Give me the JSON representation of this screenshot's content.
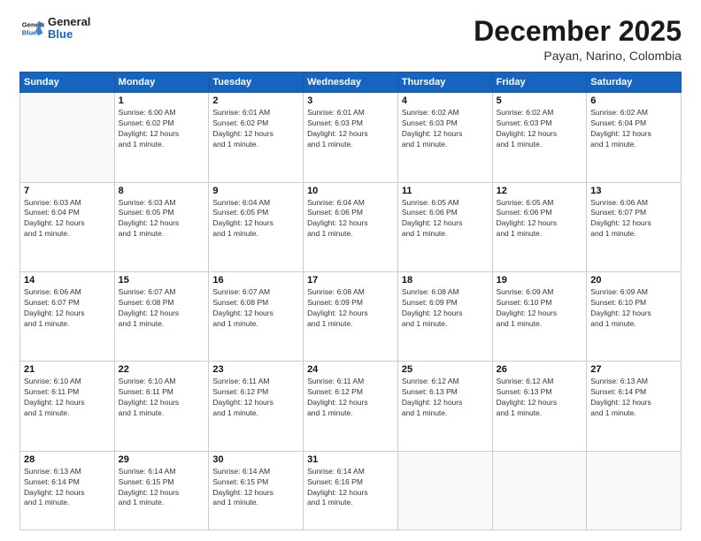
{
  "logo": {
    "line1": "General",
    "line2": "Blue"
  },
  "title": "December 2025",
  "location": "Payan, Narino, Colombia",
  "header_days": [
    "Sunday",
    "Monday",
    "Tuesday",
    "Wednesday",
    "Thursday",
    "Friday",
    "Saturday"
  ],
  "weeks": [
    [
      {
        "day": "",
        "info": ""
      },
      {
        "day": "1",
        "info": "Sunrise: 6:00 AM\nSunset: 6:02 PM\nDaylight: 12 hours\nand 1 minute."
      },
      {
        "day": "2",
        "info": "Sunrise: 6:01 AM\nSunset: 6:02 PM\nDaylight: 12 hours\nand 1 minute."
      },
      {
        "day": "3",
        "info": "Sunrise: 6:01 AM\nSunset: 6:03 PM\nDaylight: 12 hours\nand 1 minute."
      },
      {
        "day": "4",
        "info": "Sunrise: 6:02 AM\nSunset: 6:03 PM\nDaylight: 12 hours\nand 1 minute."
      },
      {
        "day": "5",
        "info": "Sunrise: 6:02 AM\nSunset: 6:03 PM\nDaylight: 12 hours\nand 1 minute."
      },
      {
        "day": "6",
        "info": "Sunrise: 6:02 AM\nSunset: 6:04 PM\nDaylight: 12 hours\nand 1 minute."
      }
    ],
    [
      {
        "day": "7",
        "info": "Sunrise: 6:03 AM\nSunset: 6:04 PM\nDaylight: 12 hours\nand 1 minute."
      },
      {
        "day": "8",
        "info": "Sunrise: 6:03 AM\nSunset: 6:05 PM\nDaylight: 12 hours\nand 1 minute."
      },
      {
        "day": "9",
        "info": "Sunrise: 6:04 AM\nSunset: 6:05 PM\nDaylight: 12 hours\nand 1 minute."
      },
      {
        "day": "10",
        "info": "Sunrise: 6:04 AM\nSunset: 6:06 PM\nDaylight: 12 hours\nand 1 minute."
      },
      {
        "day": "11",
        "info": "Sunrise: 6:05 AM\nSunset: 6:06 PM\nDaylight: 12 hours\nand 1 minute."
      },
      {
        "day": "12",
        "info": "Sunrise: 6:05 AM\nSunset: 6:06 PM\nDaylight: 12 hours\nand 1 minute."
      },
      {
        "day": "13",
        "info": "Sunrise: 6:06 AM\nSunset: 6:07 PM\nDaylight: 12 hours\nand 1 minute."
      }
    ],
    [
      {
        "day": "14",
        "info": "Sunrise: 6:06 AM\nSunset: 6:07 PM\nDaylight: 12 hours\nand 1 minute."
      },
      {
        "day": "15",
        "info": "Sunrise: 6:07 AM\nSunset: 6:08 PM\nDaylight: 12 hours\nand 1 minute."
      },
      {
        "day": "16",
        "info": "Sunrise: 6:07 AM\nSunset: 6:08 PM\nDaylight: 12 hours\nand 1 minute."
      },
      {
        "day": "17",
        "info": "Sunrise: 6:08 AM\nSunset: 6:09 PM\nDaylight: 12 hours\nand 1 minute."
      },
      {
        "day": "18",
        "info": "Sunrise: 6:08 AM\nSunset: 6:09 PM\nDaylight: 12 hours\nand 1 minute."
      },
      {
        "day": "19",
        "info": "Sunrise: 6:09 AM\nSunset: 6:10 PM\nDaylight: 12 hours\nand 1 minute."
      },
      {
        "day": "20",
        "info": "Sunrise: 6:09 AM\nSunset: 6:10 PM\nDaylight: 12 hours\nand 1 minute."
      }
    ],
    [
      {
        "day": "21",
        "info": "Sunrise: 6:10 AM\nSunset: 6:11 PM\nDaylight: 12 hours\nand 1 minute."
      },
      {
        "day": "22",
        "info": "Sunrise: 6:10 AM\nSunset: 6:11 PM\nDaylight: 12 hours\nand 1 minute."
      },
      {
        "day": "23",
        "info": "Sunrise: 6:11 AM\nSunset: 6:12 PM\nDaylight: 12 hours\nand 1 minute."
      },
      {
        "day": "24",
        "info": "Sunrise: 6:11 AM\nSunset: 6:12 PM\nDaylight: 12 hours\nand 1 minute."
      },
      {
        "day": "25",
        "info": "Sunrise: 6:12 AM\nSunset: 6:13 PM\nDaylight: 12 hours\nand 1 minute."
      },
      {
        "day": "26",
        "info": "Sunrise: 6:12 AM\nSunset: 6:13 PM\nDaylight: 12 hours\nand 1 minute."
      },
      {
        "day": "27",
        "info": "Sunrise: 6:13 AM\nSunset: 6:14 PM\nDaylight: 12 hours\nand 1 minute."
      }
    ],
    [
      {
        "day": "28",
        "info": "Sunrise: 6:13 AM\nSunset: 6:14 PM\nDaylight: 12 hours\nand 1 minute."
      },
      {
        "day": "29",
        "info": "Sunrise: 6:14 AM\nSunset: 6:15 PM\nDaylight: 12 hours\nand 1 minute."
      },
      {
        "day": "30",
        "info": "Sunrise: 6:14 AM\nSunset: 6:15 PM\nDaylight: 12 hours\nand 1 minute."
      },
      {
        "day": "31",
        "info": "Sunrise: 6:14 AM\nSunset: 6:16 PM\nDaylight: 12 hours\nand 1 minute."
      },
      {
        "day": "",
        "info": ""
      },
      {
        "day": "",
        "info": ""
      },
      {
        "day": "",
        "info": ""
      }
    ]
  ]
}
